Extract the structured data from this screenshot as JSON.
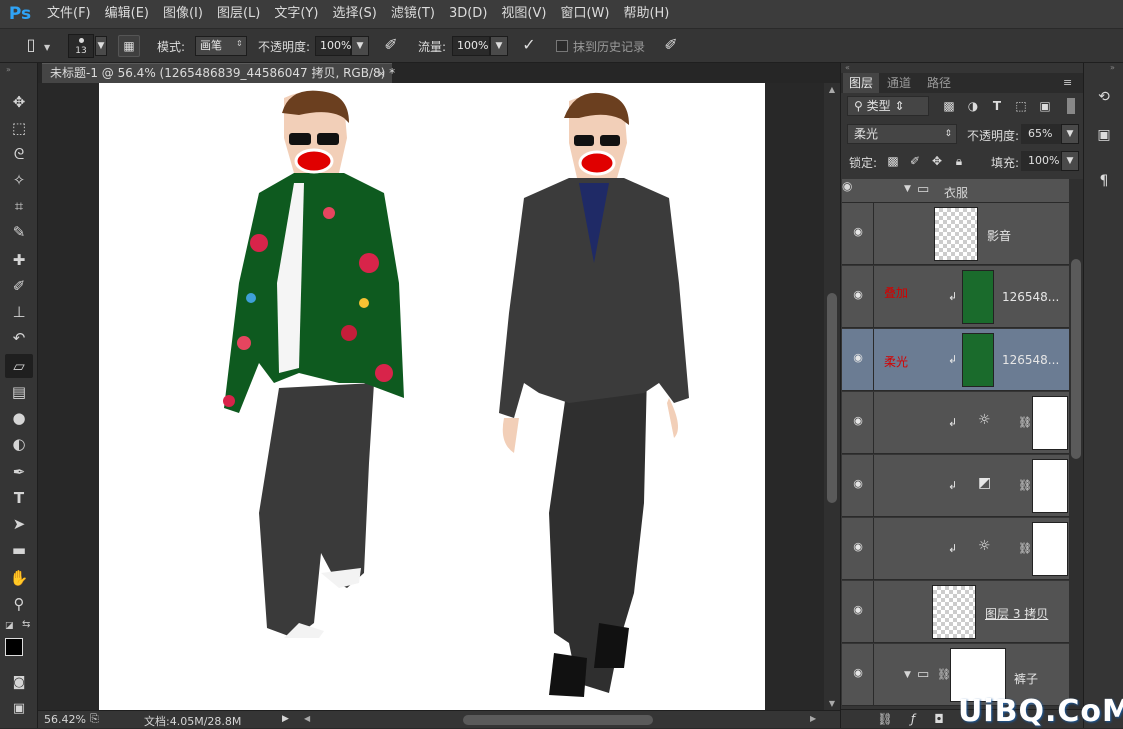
{
  "app": {
    "logo": "Ps"
  },
  "menu": [
    "文件(F)",
    "编辑(E)",
    "图像(I)",
    "图层(L)",
    "文字(Y)",
    "选择(S)",
    "滤镜(T)",
    "3D(D)",
    "视图(V)",
    "窗口(W)",
    "帮助(H)"
  ],
  "options": {
    "brush_size": "13",
    "mode_label": "模式:",
    "mode_value": "画笔",
    "opacity_label": "不透明度:",
    "opacity_value": "100%",
    "flow_label": "流量:",
    "flow_value": "100%",
    "erase_history_label": "抹到历史记录"
  },
  "document": {
    "tab_title": "未标题-1 @ 56.4% (1265486839_44586047 拷贝, RGB/8) *",
    "close": "×"
  },
  "status": {
    "zoom": "56.42%",
    "doc_info": "文档:4.05M/28.8M"
  },
  "layers_panel": {
    "tabs": [
      "图层",
      "通道",
      "路径"
    ],
    "filter_kind": "类型",
    "blend_mode": "柔光",
    "opacity_label": "不透明度:",
    "opacity_value": "65%",
    "lock_label": "锁定:",
    "fill_label": "填充:",
    "fill_value": "100%",
    "group_name": "衣服",
    "layers": [
      {
        "name": "影音",
        "note": ""
      },
      {
        "name": "126548...",
        "note": "叠加"
      },
      {
        "name": "126548...",
        "note": "柔光"
      },
      {
        "name": "",
        "note": ""
      },
      {
        "name": "",
        "note": ""
      },
      {
        "name": "",
        "note": ""
      },
      {
        "name": "图层 3 拷贝",
        "note": ""
      },
      {
        "name": "裤子",
        "note": ""
      }
    ]
  },
  "watermark": "UiBQ.CoM",
  "colors": {
    "accent": "#2fa3f6",
    "selected_layer": "#6b7c93",
    "note_red": "#d40000"
  }
}
